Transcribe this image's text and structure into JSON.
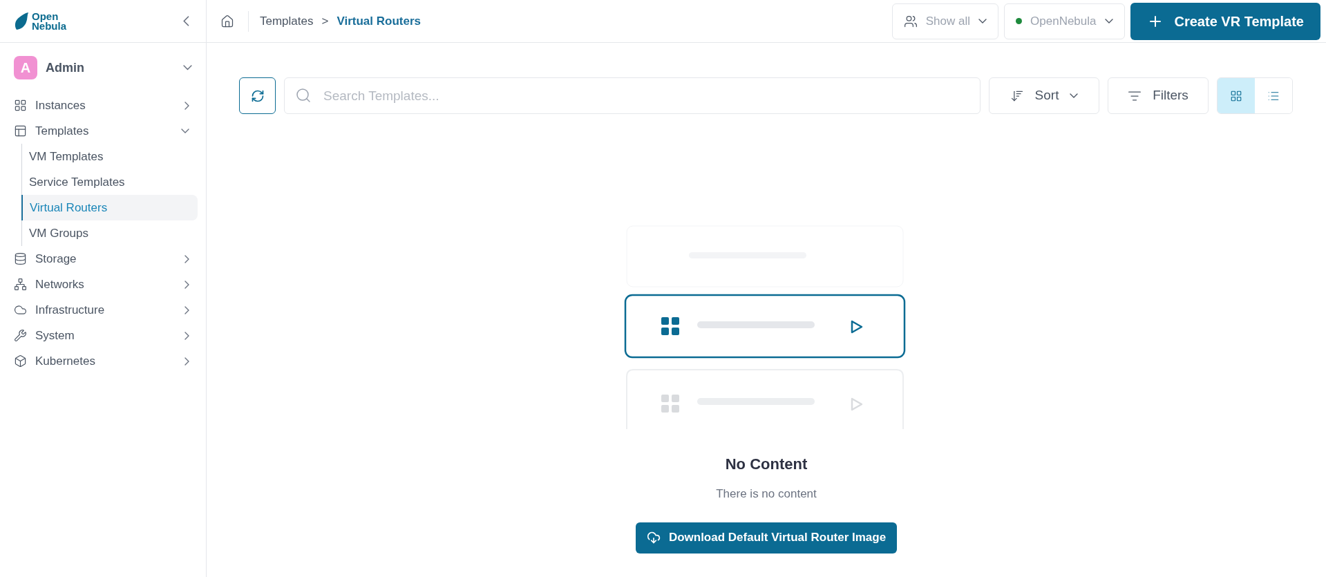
{
  "sidebar": {
    "logo": {
      "line1": "Open",
      "line2": "Nebula"
    },
    "user": {
      "initial": "A",
      "name": "Admin",
      "expanded": true
    },
    "items": [
      {
        "label": "Instances",
        "expanded": false
      },
      {
        "label": "Templates",
        "expanded": true,
        "children": [
          {
            "label": "VM Templates",
            "selected": false
          },
          {
            "label": "Service Templates",
            "selected": false
          },
          {
            "label": "Virtual Routers",
            "selected": true
          },
          {
            "label": "VM Groups",
            "selected": false
          }
        ]
      },
      {
        "label": "Storage",
        "expanded": false
      },
      {
        "label": "Networks",
        "expanded": false
      },
      {
        "label": "Infrastructure",
        "expanded": false
      },
      {
        "label": "System",
        "expanded": false
      },
      {
        "label": "Kubernetes",
        "expanded": false
      }
    ]
  },
  "header": {
    "breadcrumb": [
      "Templates",
      "Virtual Routers"
    ],
    "separator": ">",
    "group_filter": {
      "label": "Show all"
    },
    "zone": {
      "label": "OpenNebula",
      "color": "#1e8a3c"
    },
    "create_button": {
      "label": "Create VR Template"
    }
  },
  "toolbar": {
    "search": {
      "placeholder": "Search Templates..."
    },
    "sort": {
      "label": "Sort"
    },
    "filters": {
      "label": "Filters"
    },
    "views": [
      {
        "kind": "grid",
        "selected": true
      },
      {
        "kind": "list",
        "selected": false
      }
    ]
  },
  "empty_state": {
    "title": "No Content",
    "message": "There is no content",
    "button": {
      "label": "Download Default Virtual Router Image"
    }
  }
}
